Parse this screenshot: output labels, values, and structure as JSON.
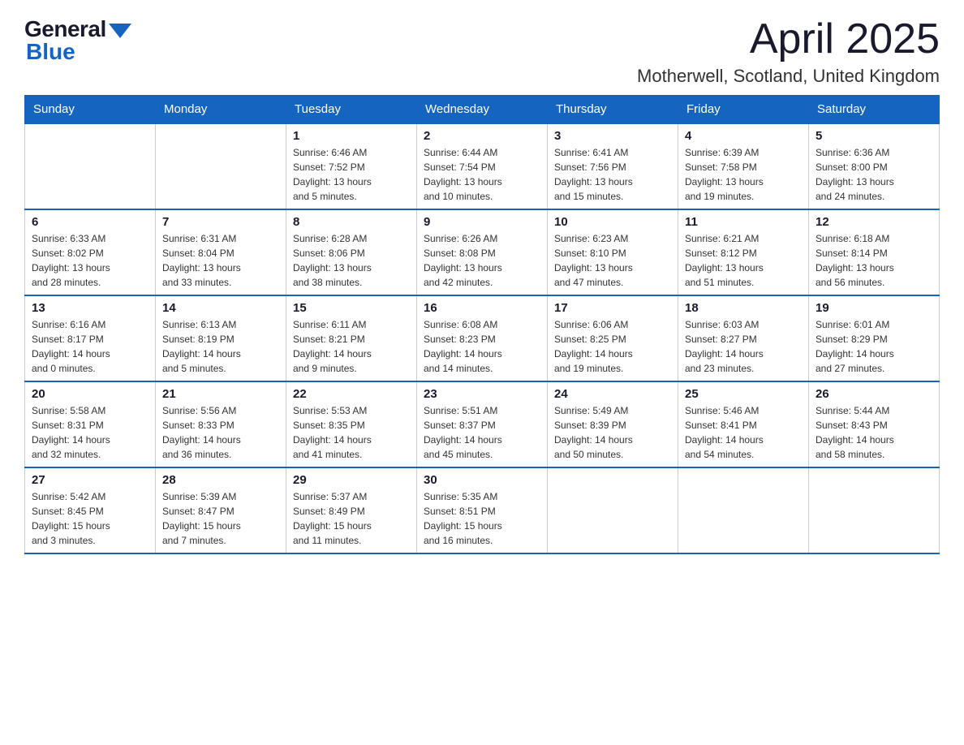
{
  "header": {
    "logo_general": "General",
    "logo_blue": "Blue",
    "month_title": "April 2025",
    "location": "Motherwell, Scotland, United Kingdom"
  },
  "days_of_week": [
    "Sunday",
    "Monday",
    "Tuesday",
    "Wednesday",
    "Thursday",
    "Friday",
    "Saturday"
  ],
  "weeks": [
    [
      {
        "day": "",
        "info": []
      },
      {
        "day": "",
        "info": []
      },
      {
        "day": "1",
        "info": [
          "Sunrise: 6:46 AM",
          "Sunset: 7:52 PM",
          "Daylight: 13 hours",
          "and 5 minutes."
        ]
      },
      {
        "day": "2",
        "info": [
          "Sunrise: 6:44 AM",
          "Sunset: 7:54 PM",
          "Daylight: 13 hours",
          "and 10 minutes."
        ]
      },
      {
        "day": "3",
        "info": [
          "Sunrise: 6:41 AM",
          "Sunset: 7:56 PM",
          "Daylight: 13 hours",
          "and 15 minutes."
        ]
      },
      {
        "day": "4",
        "info": [
          "Sunrise: 6:39 AM",
          "Sunset: 7:58 PM",
          "Daylight: 13 hours",
          "and 19 minutes."
        ]
      },
      {
        "day": "5",
        "info": [
          "Sunrise: 6:36 AM",
          "Sunset: 8:00 PM",
          "Daylight: 13 hours",
          "and 24 minutes."
        ]
      }
    ],
    [
      {
        "day": "6",
        "info": [
          "Sunrise: 6:33 AM",
          "Sunset: 8:02 PM",
          "Daylight: 13 hours",
          "and 28 minutes."
        ]
      },
      {
        "day": "7",
        "info": [
          "Sunrise: 6:31 AM",
          "Sunset: 8:04 PM",
          "Daylight: 13 hours",
          "and 33 minutes."
        ]
      },
      {
        "day": "8",
        "info": [
          "Sunrise: 6:28 AM",
          "Sunset: 8:06 PM",
          "Daylight: 13 hours",
          "and 38 minutes."
        ]
      },
      {
        "day": "9",
        "info": [
          "Sunrise: 6:26 AM",
          "Sunset: 8:08 PM",
          "Daylight: 13 hours",
          "and 42 minutes."
        ]
      },
      {
        "day": "10",
        "info": [
          "Sunrise: 6:23 AM",
          "Sunset: 8:10 PM",
          "Daylight: 13 hours",
          "and 47 minutes."
        ]
      },
      {
        "day": "11",
        "info": [
          "Sunrise: 6:21 AM",
          "Sunset: 8:12 PM",
          "Daylight: 13 hours",
          "and 51 minutes."
        ]
      },
      {
        "day": "12",
        "info": [
          "Sunrise: 6:18 AM",
          "Sunset: 8:14 PM",
          "Daylight: 13 hours",
          "and 56 minutes."
        ]
      }
    ],
    [
      {
        "day": "13",
        "info": [
          "Sunrise: 6:16 AM",
          "Sunset: 8:17 PM",
          "Daylight: 14 hours",
          "and 0 minutes."
        ]
      },
      {
        "day": "14",
        "info": [
          "Sunrise: 6:13 AM",
          "Sunset: 8:19 PM",
          "Daylight: 14 hours",
          "and 5 minutes."
        ]
      },
      {
        "day": "15",
        "info": [
          "Sunrise: 6:11 AM",
          "Sunset: 8:21 PM",
          "Daylight: 14 hours",
          "and 9 minutes."
        ]
      },
      {
        "day": "16",
        "info": [
          "Sunrise: 6:08 AM",
          "Sunset: 8:23 PM",
          "Daylight: 14 hours",
          "and 14 minutes."
        ]
      },
      {
        "day": "17",
        "info": [
          "Sunrise: 6:06 AM",
          "Sunset: 8:25 PM",
          "Daylight: 14 hours",
          "and 19 minutes."
        ]
      },
      {
        "day": "18",
        "info": [
          "Sunrise: 6:03 AM",
          "Sunset: 8:27 PM",
          "Daylight: 14 hours",
          "and 23 minutes."
        ]
      },
      {
        "day": "19",
        "info": [
          "Sunrise: 6:01 AM",
          "Sunset: 8:29 PM",
          "Daylight: 14 hours",
          "and 27 minutes."
        ]
      }
    ],
    [
      {
        "day": "20",
        "info": [
          "Sunrise: 5:58 AM",
          "Sunset: 8:31 PM",
          "Daylight: 14 hours",
          "and 32 minutes."
        ]
      },
      {
        "day": "21",
        "info": [
          "Sunrise: 5:56 AM",
          "Sunset: 8:33 PM",
          "Daylight: 14 hours",
          "and 36 minutes."
        ]
      },
      {
        "day": "22",
        "info": [
          "Sunrise: 5:53 AM",
          "Sunset: 8:35 PM",
          "Daylight: 14 hours",
          "and 41 minutes."
        ]
      },
      {
        "day": "23",
        "info": [
          "Sunrise: 5:51 AM",
          "Sunset: 8:37 PM",
          "Daylight: 14 hours",
          "and 45 minutes."
        ]
      },
      {
        "day": "24",
        "info": [
          "Sunrise: 5:49 AM",
          "Sunset: 8:39 PM",
          "Daylight: 14 hours",
          "and 50 minutes."
        ]
      },
      {
        "day": "25",
        "info": [
          "Sunrise: 5:46 AM",
          "Sunset: 8:41 PM",
          "Daylight: 14 hours",
          "and 54 minutes."
        ]
      },
      {
        "day": "26",
        "info": [
          "Sunrise: 5:44 AM",
          "Sunset: 8:43 PM",
          "Daylight: 14 hours",
          "and 58 minutes."
        ]
      }
    ],
    [
      {
        "day": "27",
        "info": [
          "Sunrise: 5:42 AM",
          "Sunset: 8:45 PM",
          "Daylight: 15 hours",
          "and 3 minutes."
        ]
      },
      {
        "day": "28",
        "info": [
          "Sunrise: 5:39 AM",
          "Sunset: 8:47 PM",
          "Daylight: 15 hours",
          "and 7 minutes."
        ]
      },
      {
        "day": "29",
        "info": [
          "Sunrise: 5:37 AM",
          "Sunset: 8:49 PM",
          "Daylight: 15 hours",
          "and 11 minutes."
        ]
      },
      {
        "day": "30",
        "info": [
          "Sunrise: 5:35 AM",
          "Sunset: 8:51 PM",
          "Daylight: 15 hours",
          "and 16 minutes."
        ]
      },
      {
        "day": "",
        "info": []
      },
      {
        "day": "",
        "info": []
      },
      {
        "day": "",
        "info": []
      }
    ]
  ]
}
